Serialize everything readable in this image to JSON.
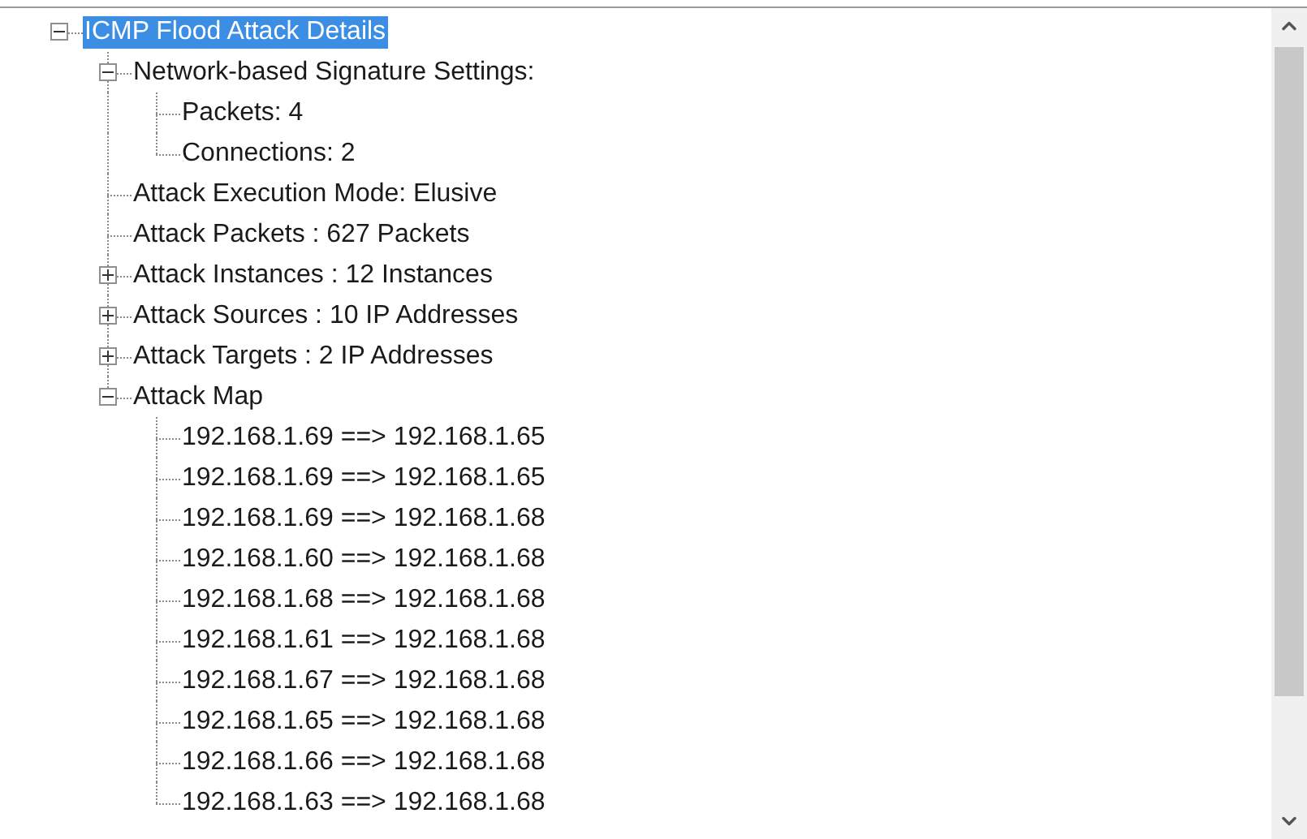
{
  "tree": [
    {
      "label": "ICMP Flood Attack Details",
      "selected": true,
      "expanded": true,
      "children": [
        {
          "label": "Network-based Signature Settings:",
          "selected": false,
          "expanded": true,
          "children": [
            {
              "label": "Packets: 4",
              "selected": false
            },
            {
              "label": "Connections: 2",
              "selected": false
            }
          ]
        },
        {
          "label": "Attack Execution Mode: Elusive",
          "selected": false
        },
        {
          "label": "Attack Packets : 627 Packets",
          "selected": false
        },
        {
          "label": "Attack Instances : 12 Instances",
          "selected": false,
          "expanded": false
        },
        {
          "label": "Attack Sources : 10 IP Addresses",
          "selected": false,
          "expanded": false
        },
        {
          "label": "Attack Targets : 2 IP Addresses",
          "selected": false,
          "expanded": false
        },
        {
          "label": "Attack Map",
          "selected": false,
          "expanded": true,
          "children": [
            {
              "label": "192.168.1.69 ==> 192.168.1.65",
              "selected": false
            },
            {
              "label": "192.168.1.69 ==> 192.168.1.65",
              "selected": false
            },
            {
              "label": "192.168.1.69 ==> 192.168.1.68",
              "selected": false
            },
            {
              "label": "192.168.1.60 ==> 192.168.1.68",
              "selected": false
            },
            {
              "label": "192.168.1.68 ==> 192.168.1.68",
              "selected": false
            },
            {
              "label": "192.168.1.61 ==> 192.168.1.68",
              "selected": false
            },
            {
              "label": "192.168.1.67 ==> 192.168.1.68",
              "selected": false
            },
            {
              "label": "192.168.1.65 ==> 192.168.1.68",
              "selected": false
            },
            {
              "label": "192.168.1.66 ==> 192.168.1.68",
              "selected": false
            },
            {
              "label": "192.168.1.63 ==> 192.168.1.68",
              "selected": false
            }
          ]
        }
      ]
    }
  ]
}
